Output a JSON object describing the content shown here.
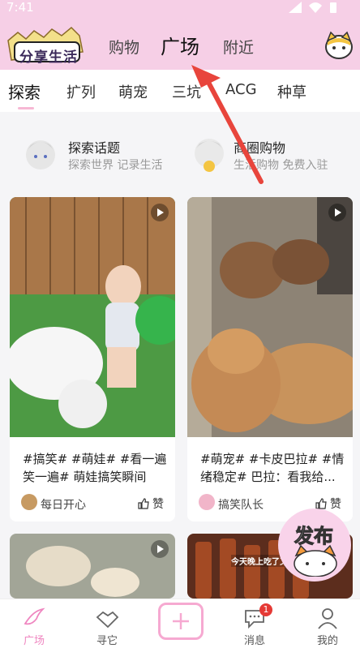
{
  "status": {
    "time": "7:41"
  },
  "logo": {
    "text": "分享生活"
  },
  "top_tabs": [
    {
      "label": "购物"
    },
    {
      "label": "广场"
    },
    {
      "label": "附近"
    }
  ],
  "sub_tabs": [
    {
      "label": "探索"
    },
    {
      "label": "扩列"
    },
    {
      "label": "萌宠"
    },
    {
      "label": "三坑"
    },
    {
      "label": "ACG"
    },
    {
      "label": "种草"
    }
  ],
  "topics": [
    {
      "title": "探索话题",
      "subtitle": "探索世界 记录生活"
    },
    {
      "title": "商圈购物",
      "subtitle": "生活购物 免费入驻"
    }
  ],
  "cards": [
    {
      "caption": "#搞笑# #萌娃# #看一遍笑一遍# 萌娃搞笑瞬间",
      "author": "每日开心",
      "like_label": "赞"
    },
    {
      "caption": "#萌宠# #卡皮巴拉# #情绪稳定# 巴拉：看我给...",
      "author": "搞笑队长",
      "like_label": "赞"
    },
    {
      "image_text": "今天晚上吃了又"
    }
  ],
  "fab": {
    "label": "发布"
  },
  "bottom_nav": [
    {
      "label": "广场"
    },
    {
      "label": "寻它"
    },
    {
      "label": ""
    },
    {
      "label": "消息",
      "badge": "1"
    },
    {
      "label": "我的"
    }
  ],
  "colors": {
    "accent_pink": "#f6cfe6",
    "active_nav": "#ef86c0",
    "arrow_red": "#e8453c"
  }
}
